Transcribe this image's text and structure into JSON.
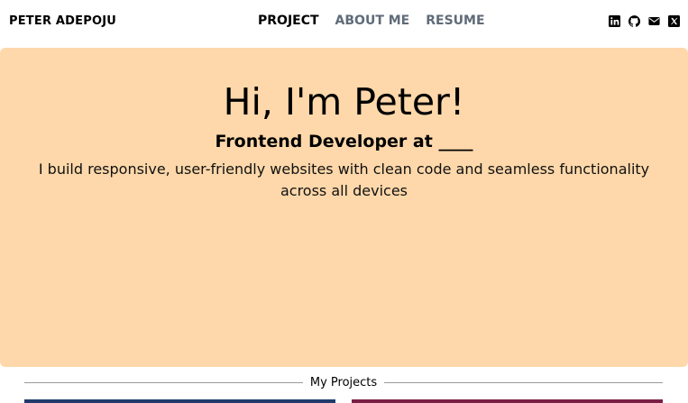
{
  "navbar": {
    "brand": "PETER ADEPOJU",
    "links": [
      {
        "label": "PROJECT",
        "active": true
      },
      {
        "label": "ABOUT ME",
        "active": false
      },
      {
        "label": "RESUME",
        "active": false
      }
    ],
    "socials": [
      "linkedin-icon",
      "github-icon",
      "envelope-icon",
      "x-twitter-icon"
    ]
  },
  "hero": {
    "title": "Hi, I'm Peter!",
    "subtitle": "Frontend Developer at ____",
    "description": "I build responsive, user-friendly websites with clean code and seamless functionality across all devices",
    "background_color": "#fed8aa"
  },
  "projects": {
    "heading": "My Projects",
    "card_colors": [
      "#1f3a6b",
      "#7a1f46"
    ]
  },
  "colors": {
    "nav_active": "#000000",
    "nav_muted": "#5f6b78"
  }
}
